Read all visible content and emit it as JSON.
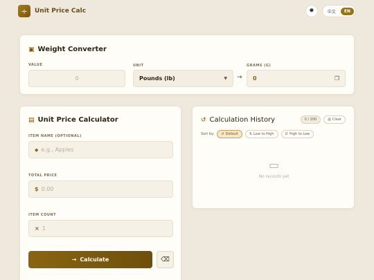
{
  "header": {
    "logo_glyph": "÷",
    "title": "Unit Price Calc",
    "theme_icon": "sun-icon",
    "lang_options": [
      "中文",
      "EN"
    ],
    "lang_active": "EN"
  },
  "weight": {
    "title": "Weight Converter",
    "value_label": "VALUE",
    "value_placeholder": "0",
    "unit_label": "UNIT",
    "unit_selected": "Pounds (lb)",
    "grams_label": "GRAMS (G)",
    "grams_value": "0"
  },
  "calc": {
    "title": "Unit Price Calculator",
    "item_name_label": "ITEM NAME (OPTIONAL)",
    "item_name_placeholder": "e.g., Apples",
    "total_price_label": "TOTAL PRICE",
    "total_price_prefix": "$",
    "total_price_placeholder": "0.00",
    "item_count_label": "ITEM COUNT",
    "item_count_prefix": "×",
    "item_count_placeholder": "1",
    "calculate_label": "Calculate"
  },
  "history": {
    "title": "Calculation History",
    "count": "0 / 200",
    "clear_label": "Clear",
    "sort_label": "Sort by:",
    "sort_options": [
      "Default",
      "Low to High",
      "High to Low"
    ],
    "empty_text": "No records yet"
  },
  "colors": {
    "accent": "#8a6410",
    "background": "#efe8dc",
    "card": "#fffdf8"
  }
}
